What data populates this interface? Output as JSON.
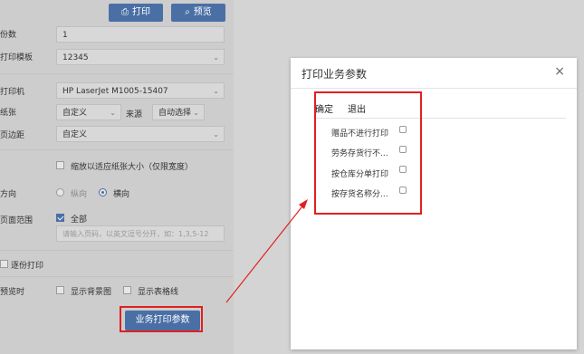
{
  "toolbar": {
    "print_label": "打印",
    "preview_label": "预览"
  },
  "settings": {
    "copies_label": "份数",
    "copies_value": "1",
    "template_label": "打印模板",
    "template_value": "12345",
    "printer_label": "打印机",
    "printer_value": "HP LaserJet M1005-15407",
    "paper_label": "纸张",
    "paper_value": "自定义",
    "source_label": "来源",
    "source_value": "自动选择",
    "margin_label": "页边距",
    "margin_value": "自定义",
    "shrink_label": "缩放以适应纸张大小（仅限宽度）",
    "orientation_label": "方向",
    "portrait_label": "纵向",
    "landscape_label": "横向",
    "range_label": "页面范围",
    "all_label": "全部",
    "range_placeholder": "请输入页码，以英文逗号分开，如：1,3,5-12",
    "collate_label": "逐份打印",
    "preview_label": "预览时",
    "show_bg_label": "显示背景图",
    "show_grid_label": "显示表格线",
    "biz_params_button": "业务打印参数"
  },
  "dialog": {
    "title": "打印业务参数",
    "close_glyph": "×",
    "confirm_label": "确定",
    "exit_label": "退出",
    "options": [
      {
        "label": "赠品不进行打印"
      },
      {
        "label": "劳务存货行不..."
      },
      {
        "label": "按仓库分单打印"
      },
      {
        "label": "按存货名称分..."
      }
    ]
  }
}
